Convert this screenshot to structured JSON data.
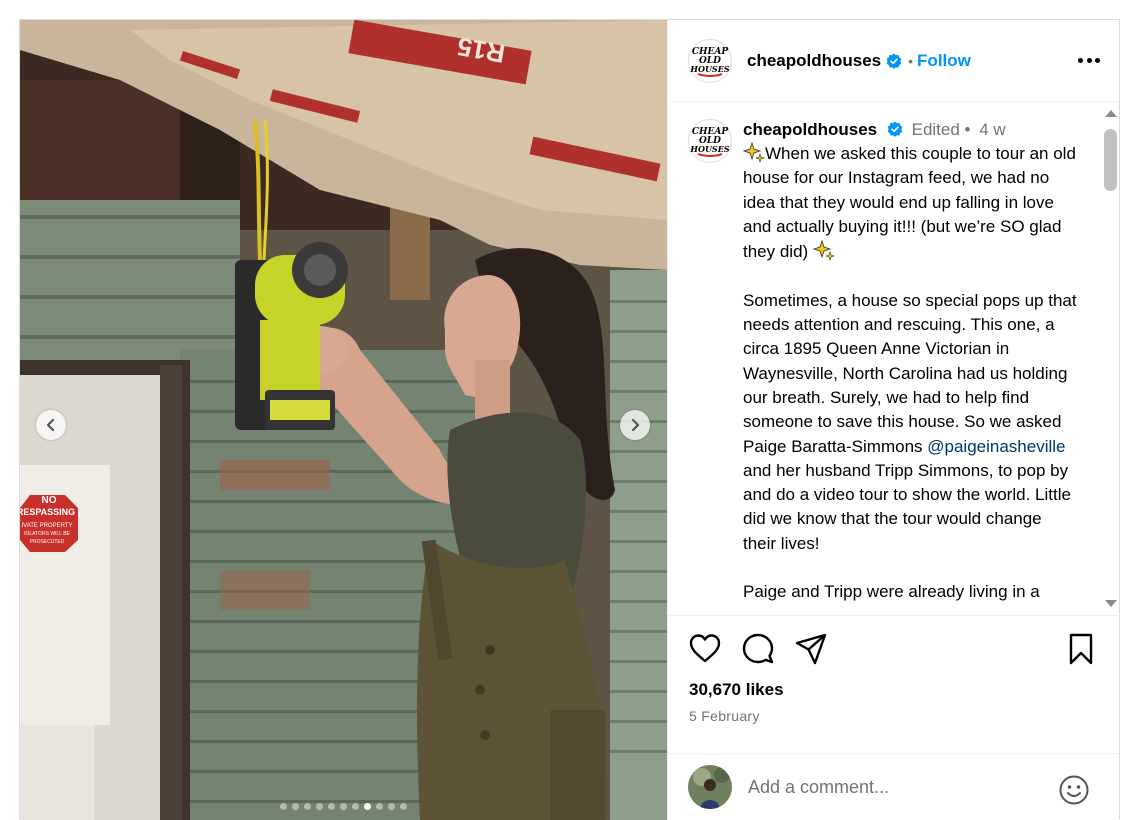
{
  "header": {
    "username": "cheapoldhouses",
    "separator": "•",
    "follow_label": "Follow",
    "avatar_text": [
      "CHEAP",
      "OLD",
      "HOUSES"
    ]
  },
  "caption": {
    "username": "cheapoldhouses",
    "edited_label": "Edited •",
    "time_ago": "4 w",
    "text_1": "When we asked this couple to tour an old house for our Instagram feed, we had no idea that they would end up falling in love and actually buying it!!! (but we’re SO glad they did) ",
    "text_2": "Sometimes, a house so special pops up that needs attention and rescuing. This one, a circa 1895 Queen Anne Victorian in Waynesville, North Carolina had us holding our breath. Surely, we had to help find someone to save this house. So we asked Paige Baratta-Simmons ",
    "mention": "@paigeinasheville",
    "text_3": " and her husband Tripp Simmons, to pop by and do a video tour to show the world. Little did we know that the tour would change their lives!",
    "text_4": "Paige and Tripp were already living in a"
  },
  "photo": {
    "sign_line1": "NO",
    "sign_line2": "RESPASSING",
    "sign_line3": "IVATE PROPERTY",
    "sign_line4": "IOLATORS WILL BE",
    "sign_line5": "PROSECUTED",
    "insulation_label": "R15",
    "total_slides": 11,
    "active_slide": 8
  },
  "actions": {
    "likes": "30,670 likes",
    "date": "5 February"
  },
  "comment": {
    "placeholder": "Add a comment..."
  },
  "colors": {
    "follow_blue": "#0095f6",
    "mention_blue": "#00376b",
    "verified_blue": "#0095f6",
    "secondary_text": "#737373"
  }
}
